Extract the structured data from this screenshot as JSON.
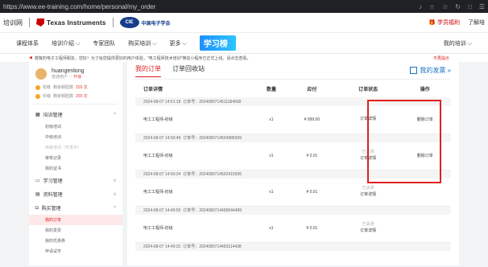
{
  "browser": {
    "url": "https://www.ee-training.com/home/personal/my_order",
    "tools": [
      "♪",
      "☆",
      "☆",
      "↻",
      "□",
      "☰"
    ]
  },
  "header": {
    "left_title": "培训网",
    "ti_logo": "Texas Instruments",
    "logo2_text": "中国电子学会",
    "right_gift": "🎁 学员福利",
    "right_about": "了解培"
  },
  "nav": {
    "items": [
      "课程体系",
      "培训介绍 ⌵",
      "专家团队",
      "购买培训 ⌵",
      "更多 ⌵"
    ],
    "banner": "学习榜",
    "right": "我的培训 ⌵"
  },
  "notice": {
    "text": "尊敬的电子工程师朋友，您好！为了给您提供更好的用户体验，\"电工程师技术培训\"微信小程序已正式上线。请点击查看。",
    "hide": "不再提示"
  },
  "user": {
    "name": "huangenlong",
    "roles": "普通用户 ♡",
    "upgrade": "升级"
  },
  "stats": [
    {
      "label": "初级",
      "detail": "剩余钥匙数",
      "value": "255 次"
    },
    {
      "label": "中级",
      "detail": "剩余钥匙数",
      "value": "255 次"
    }
  ],
  "sidebar": {
    "groups": [
      {
        "label": "培训管理",
        "icon": "grid-icon",
        "items": [
          "初级培训",
          "中级培训",
          "高级培训（开发中）",
          "审核记录",
          "我的证书"
        ]
      },
      {
        "label": "学习管理",
        "icon": "monitor-icon",
        "items": []
      },
      {
        "label": "资料管理",
        "icon": "file-icon",
        "items": []
      },
      {
        "label": "购买管理",
        "icon": "bag-icon",
        "items": [
          "我的订单",
          "我的发票",
          "我的优惠券",
          "申请试学"
        ]
      }
    ],
    "active_item": "我的订单"
  },
  "tabs": {
    "items": [
      "我的订单",
      "订单回收站"
    ],
    "invoice": "我的发票 »"
  },
  "table": {
    "headers": [
      "订单详情",
      "数量",
      "应付",
      "订单状态",
      "操作"
    ],
    "orders": [
      {
        "time": "2024-08-07 14:51:18",
        "no": "订单号：2024080714511184568",
        "name": "电工工程师-初级",
        "qty": "x1",
        "price": "¥ 999.00",
        "status": "",
        "status_link": "订单详情",
        "action": "删除订单"
      },
      {
        "time": "2024-08-07 14:50:49",
        "no": "订单号：2024080714504986509",
        "name": "电工工程师-初级",
        "qty": "x1",
        "price": "¥ 0.01",
        "status": "已关闭",
        "status_link": "订单详情",
        "action": "删除订单"
      },
      {
        "time": "2024-08-07 14:50:24",
        "no": "订单号：2024080714502415506",
        "name": "电工工程师-初级",
        "qty": "x1",
        "price": "¥ 0.01",
        "status": "已关闭",
        "status_link": "订单详情",
        "action": ""
      },
      {
        "time": "2024-08-07 14:49:55",
        "no": "订单号：2024080714495544499",
        "name": "电工工程师-初级",
        "qty": "x1",
        "price": "¥ 0.01",
        "status": "已关闭",
        "status_link": "订单详情",
        "action": ""
      },
      {
        "time": "2024-08-07 14:49:31",
        "no": "订单号：2024080714493114438",
        "name": "",
        "qty": "",
        "price": "",
        "status": "",
        "status_link": "",
        "action": ""
      }
    ]
  },
  "highlight_color": "#e02020"
}
